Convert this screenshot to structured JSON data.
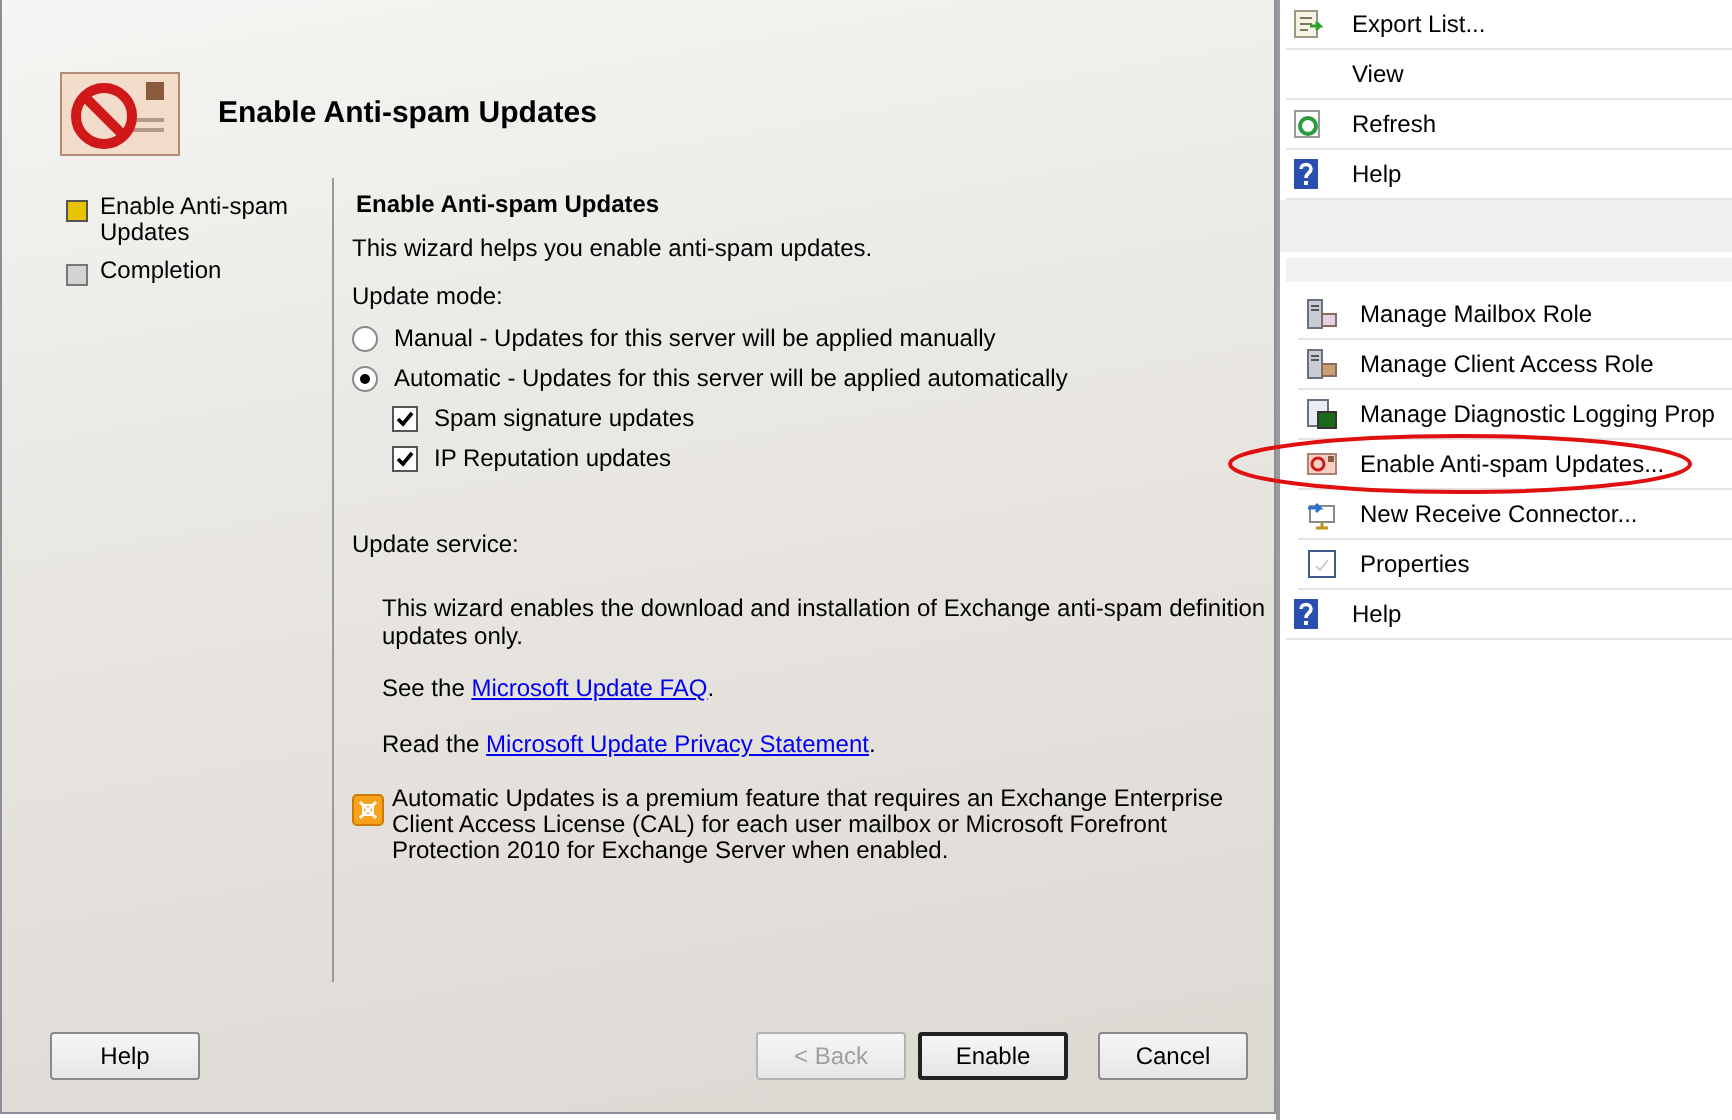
{
  "wizard": {
    "title": "Enable Anti-spam Updates",
    "steps": [
      {
        "label": "Enable Anti-spam Updates",
        "selected": true
      },
      {
        "label": "Completion",
        "selected": false
      }
    ],
    "page": {
      "heading": "Enable Anti-spam Updates",
      "intro": "This wizard helps you enable anti-spam updates.",
      "update_mode": {
        "label": "Update mode:",
        "options": [
          {
            "label": "Manual - Updates for this server will be applied manually",
            "selected": false
          },
          {
            "label": "Automatic - Updates for this server will be applied automatically",
            "selected": true
          }
        ],
        "checkboxes": [
          {
            "label": "Spam signature updates",
            "checked": true
          },
          {
            "label": "IP Reputation updates",
            "checked": true
          }
        ]
      },
      "update_service": {
        "label": "Update service:",
        "description": "This wizard enables the download and installation of Exchange anti-spam definition updates only.",
        "links": [
          {
            "prefix": "See the",
            "link": "Microsoft Update FAQ",
            "suffix": "."
          },
          {
            "prefix": "Read the",
            "link": "Microsoft Update Privacy Statement",
            "suffix": "."
          }
        ]
      },
      "notice": "Automatic Updates is a premium feature that requires an Exchange Enterprise Client Access License (CAL) for each user mailbox or Microsoft Forefront Protection 2010 for Exchange Server when enabled."
    },
    "buttons": [
      {
        "label": "Help",
        "disabled": false,
        "default": false
      },
      {
        "label": "< Back",
        "disabled": true,
        "default": false
      },
      {
        "label": "Enable",
        "disabled": false,
        "default": true
      },
      {
        "label": "Cancel",
        "disabled": false,
        "default": false
      }
    ]
  },
  "actions": {
    "groups": [
      {
        "items": [
          {
            "label": "Export List...",
            "kind": "export",
            "highlighted": false
          },
          {
            "label": "View",
            "kind": "none",
            "highlighted": false
          },
          {
            "label": "Refresh",
            "kind": "refresh",
            "highlighted": false
          },
          {
            "label": "Help",
            "kind": "help",
            "highlighted": false
          }
        ]
      },
      {
        "items": [
          {
            "label": "Manage Mailbox Role",
            "kind": "mailbox",
            "highlighted": false
          },
          {
            "label": "Manage Client Access Role",
            "kind": "client",
            "highlighted": false
          },
          {
            "label": "Manage Diagnostic Logging Prop",
            "kind": "logging",
            "highlighted": false
          },
          {
            "label": "Enable Anti-spam Updates...",
            "kind": "antispam",
            "highlighted": true
          },
          {
            "label": "New Receive Connector...",
            "kind": "connector",
            "highlighted": false
          },
          {
            "label": "Properties",
            "kind": "properties",
            "highlighted": false
          },
          {
            "label": "Help",
            "kind": "help",
            "highlighted": false
          }
        ]
      }
    ]
  }
}
